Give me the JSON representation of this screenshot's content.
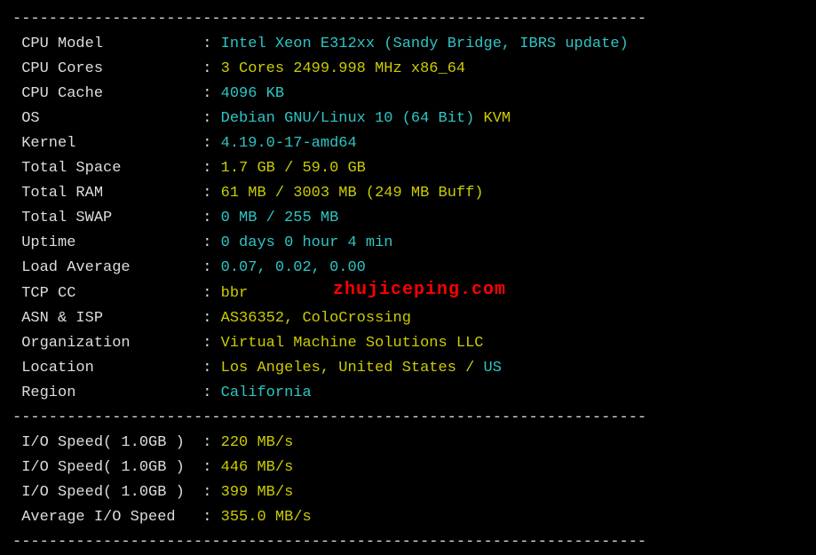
{
  "divider": "----------------------------------------------------------------------",
  "rows": [
    {
      "label": " CPU Model          ",
      "colon": " : ",
      "parts": [
        {
          "cls": "cyan",
          "text": "Intel Xeon E312xx (Sandy Bridge, IBRS update)"
        }
      ]
    },
    {
      "label": " CPU Cores          ",
      "colon": " : ",
      "parts": [
        {
          "cls": "yellow",
          "text": "3 Cores 2499.998 MHz x86_64"
        }
      ]
    },
    {
      "label": " CPU Cache          ",
      "colon": " : ",
      "parts": [
        {
          "cls": "cyan",
          "text": "4096 KB"
        }
      ]
    },
    {
      "label": " OS                 ",
      "colon": " : ",
      "parts": [
        {
          "cls": "cyan",
          "text": "Debian GNU/Linux 10 (64 Bit) "
        },
        {
          "cls": "yellow",
          "text": "KVM"
        }
      ]
    },
    {
      "label": " Kernel             ",
      "colon": " : ",
      "parts": [
        {
          "cls": "cyan",
          "text": "4.19.0-17-amd64"
        }
      ]
    },
    {
      "label": " Total Space        ",
      "colon": " : ",
      "parts": [
        {
          "cls": "yellow",
          "text": "1.7 GB / 59.0 GB"
        }
      ]
    },
    {
      "label": " Total RAM          ",
      "colon": " : ",
      "parts": [
        {
          "cls": "yellow",
          "text": "61 MB / 3003 MB (249 MB Buff)"
        }
      ]
    },
    {
      "label": " Total SWAP         ",
      "colon": " : ",
      "parts": [
        {
          "cls": "cyan",
          "text": "0 MB / 255 MB"
        }
      ]
    },
    {
      "label": " Uptime             ",
      "colon": " : ",
      "parts": [
        {
          "cls": "cyan",
          "text": "0 days 0 hour 4 min"
        }
      ]
    },
    {
      "label": " Load Average       ",
      "colon": " : ",
      "parts": [
        {
          "cls": "cyan",
          "text": "0.07, 0.02, 0.00"
        }
      ]
    },
    {
      "label": " TCP CC             ",
      "colon": " : ",
      "parts": [
        {
          "cls": "yellow",
          "text": "bbr"
        }
      ]
    },
    {
      "label": " ASN & ISP          ",
      "colon": " : ",
      "parts": [
        {
          "cls": "yellow",
          "text": "AS36352, ColoCrossing"
        }
      ]
    },
    {
      "label": " Organization       ",
      "colon": " : ",
      "parts": [
        {
          "cls": "yellow",
          "text": "Virtual Machine Solutions LLC"
        }
      ]
    },
    {
      "label": " Location           ",
      "colon": " : ",
      "parts": [
        {
          "cls": "yellow",
          "text": "Los Angeles, United States / "
        },
        {
          "cls": "cyan",
          "text": "US"
        }
      ]
    },
    {
      "label": " Region             ",
      "colon": " : ",
      "parts": [
        {
          "cls": "cyan",
          "text": "California"
        }
      ]
    }
  ],
  "io_rows": [
    {
      "label": " I/O Speed( 1.0GB ) ",
      "colon": " : ",
      "parts": [
        {
          "cls": "yellow",
          "text": "220 MB/s"
        }
      ]
    },
    {
      "label": " I/O Speed( 1.0GB ) ",
      "colon": " : ",
      "parts": [
        {
          "cls": "yellow",
          "text": "446 MB/s"
        }
      ]
    },
    {
      "label": " I/O Speed( 1.0GB ) ",
      "colon": " : ",
      "parts": [
        {
          "cls": "yellow",
          "text": "399 MB/s"
        }
      ]
    },
    {
      "label": " Average I/O Speed  ",
      "colon": " : ",
      "parts": [
        {
          "cls": "yellow",
          "text": "355.0 MB/s"
        }
      ]
    }
  ],
  "watermark": "zhujiceping.com"
}
